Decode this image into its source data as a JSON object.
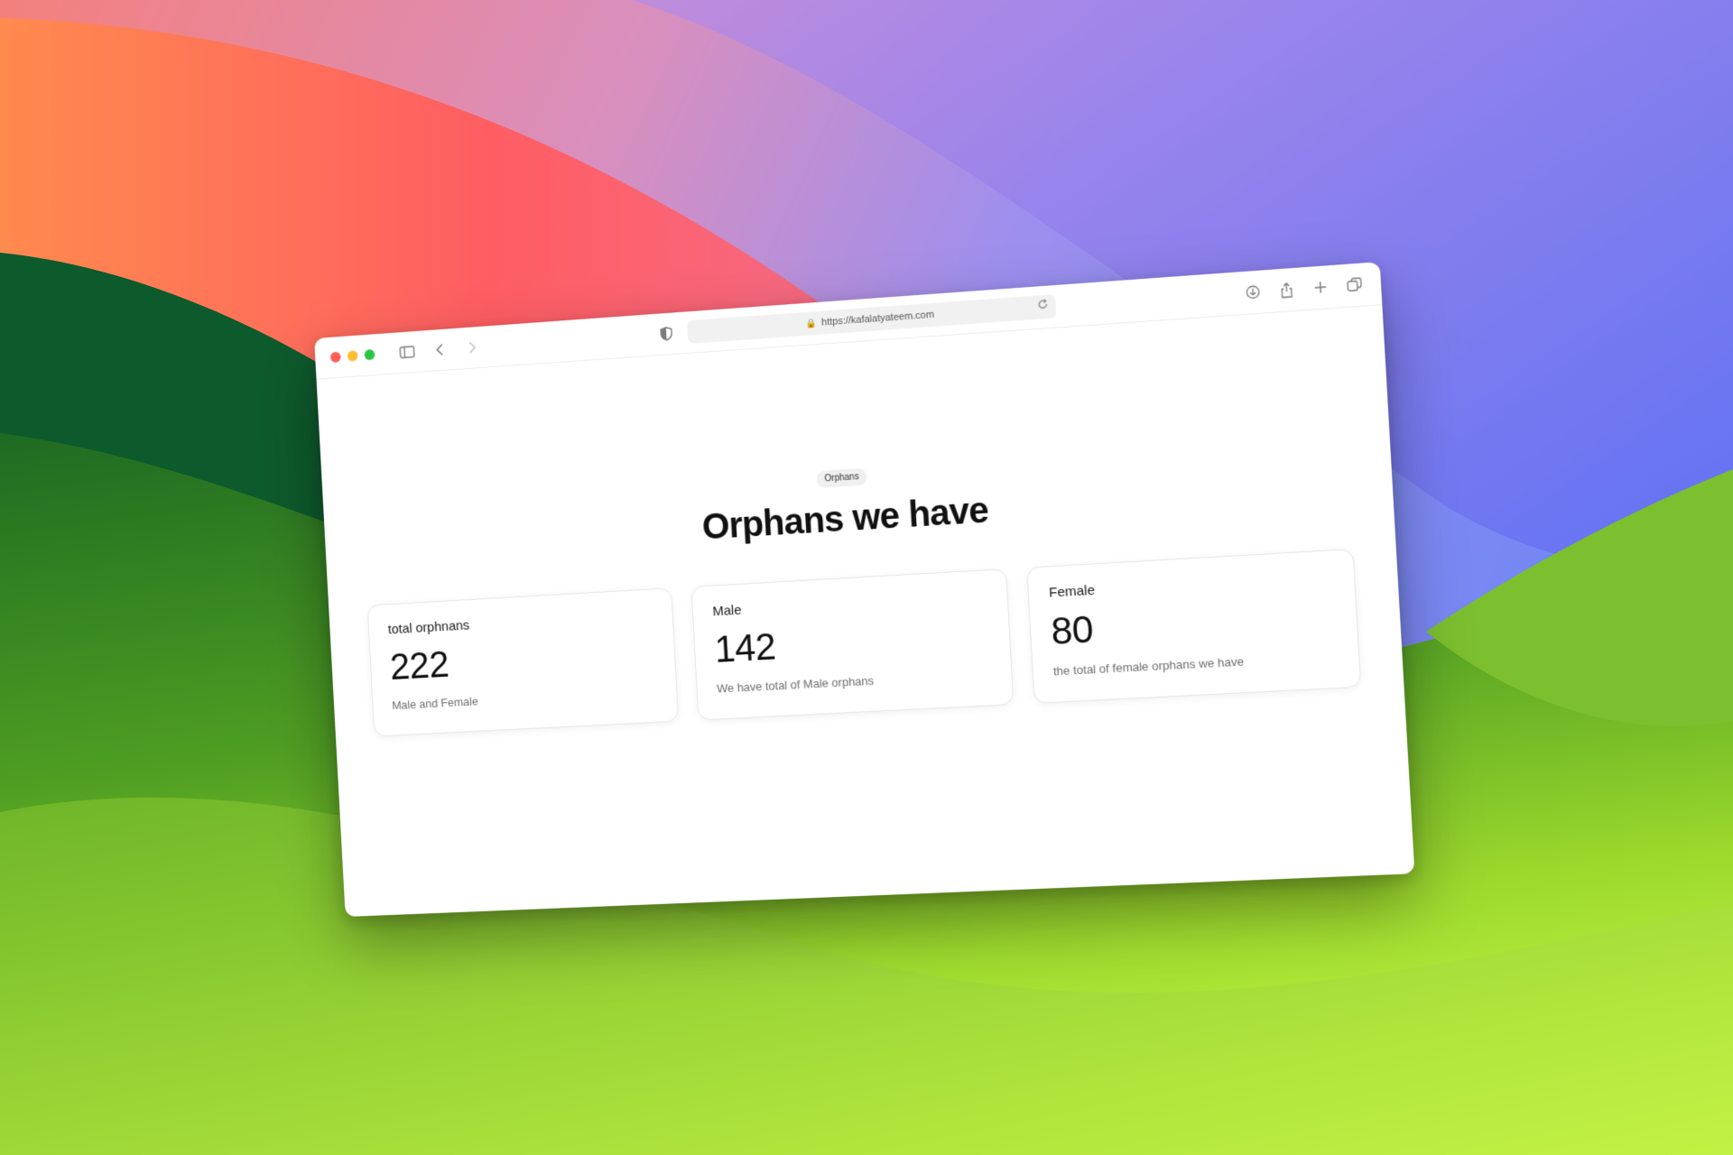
{
  "browser": {
    "url": "https://kafalatyateem.com",
    "lock_icon": "lock-icon",
    "icons": [
      "sidebar-icon",
      "back-icon",
      "forward-icon",
      "shield-icon",
      "reload-icon",
      "download-icon",
      "share-icon",
      "new-tab-icon",
      "tab-overview-icon"
    ]
  },
  "page": {
    "badge": "Orphans",
    "title": "Orphans we have",
    "cards": [
      {
        "title": "total orphnans",
        "value": "222",
        "description": "Male and Female"
      },
      {
        "title": "Male",
        "value": "142",
        "description": "We have total of Male orphans"
      },
      {
        "title": "Female",
        "value": "80",
        "description": "the total of female orphans we have"
      }
    ]
  },
  "colors": {
    "traffic_red": "#fe5f57",
    "traffic_yellow": "#febc2e",
    "traffic_green": "#28c840"
  }
}
